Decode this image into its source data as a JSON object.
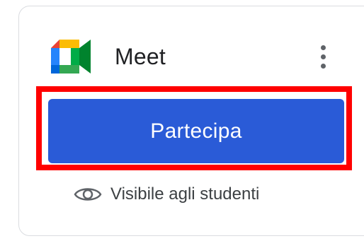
{
  "card": {
    "app_name": "Meet",
    "join_label": "Partecipa",
    "visibility_text": "Visibile agli studenti",
    "icons": {
      "logo": "google-meet-logo",
      "more": "more-vert-icon",
      "visibility": "eye-icon"
    }
  },
  "colors": {
    "button": "#2a5bd7",
    "highlight": "#ff0000"
  }
}
